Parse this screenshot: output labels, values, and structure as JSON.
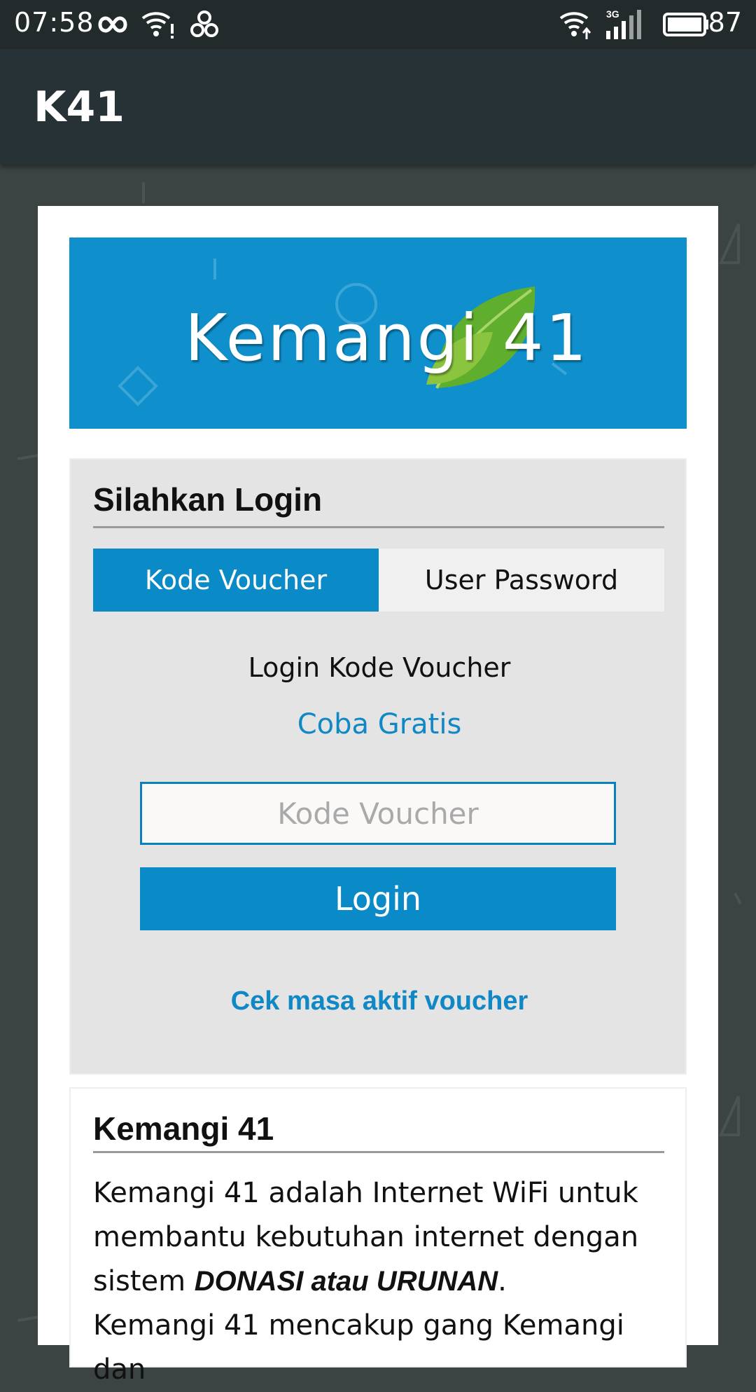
{
  "status_bar": {
    "time": "07:58",
    "battery_level": "87",
    "network_type": "3G",
    "icons": [
      "infinity-icon",
      "wifi-alert-icon",
      "cloverleaf-icon",
      "wifi-upload-icon",
      "cell-signal-icon",
      "battery-icon"
    ]
  },
  "app_bar": {
    "title": "K41"
  },
  "banner": {
    "brand_text": "Kemangi 41"
  },
  "login": {
    "title": "Silahkan Login",
    "tabs": [
      {
        "label": "Kode Voucher",
        "active": true
      },
      {
        "label": "User Password",
        "active": false
      }
    ],
    "subtitle": "Login Kode Voucher",
    "trial_link": "Coba Gratis",
    "voucher_placeholder": "Kode Voucher",
    "voucher_value": "",
    "login_button": "Login",
    "check_link": "Cek masa aktif voucher"
  },
  "info": {
    "title": "Kemangi 41",
    "para1_text": "Kemangi 41 adalah Internet WiFi untuk membantu kebutuhan internet dengan sistem ",
    "para1_emphasis": "DONASI atau URUNAN",
    "para1_end": ".",
    "para2_text": "Kemangi 41 mencakup gang Kemangi dan"
  },
  "colors": {
    "accent": "#0a8ac6",
    "link": "#1088c5",
    "app_bar": "#263236",
    "status_bar": "#222a2c",
    "background": "#3b4343",
    "panel": "#e4e4e4"
  }
}
